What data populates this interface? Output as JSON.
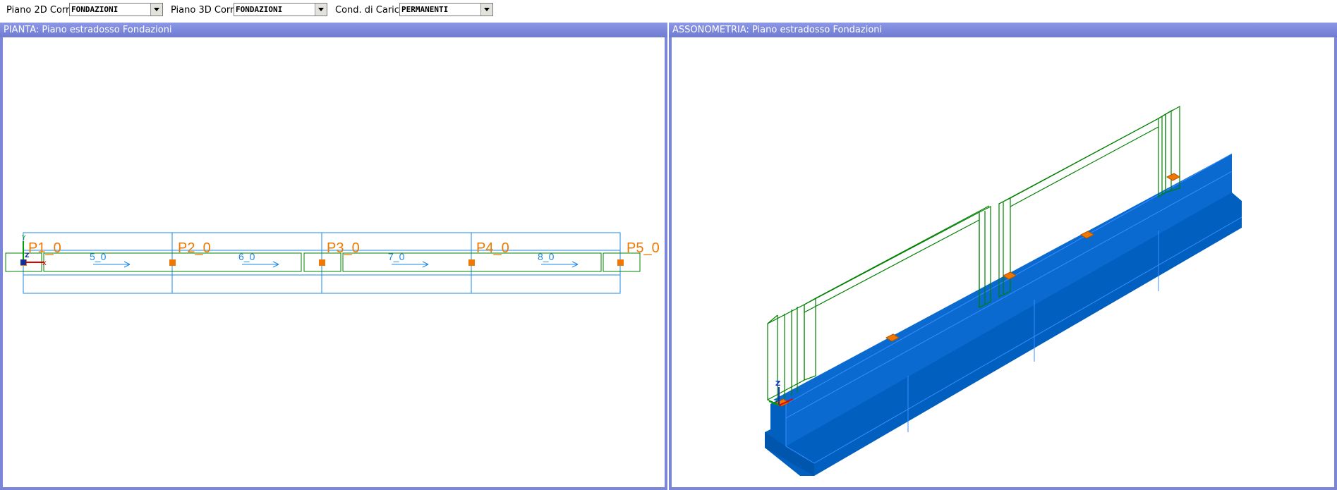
{
  "toolbar": {
    "piano2d_label": "Piano 2D Corr.",
    "piano2d_value": "FONDAZIONI",
    "piano3d_label": "Piano 3D Corr.",
    "piano3d_value": "FONDAZIONI",
    "cond_label": "Cond. di Carico",
    "cond_value": "PERMANENTI"
  },
  "plan_view": {
    "title": "PIANTA: Piano estradosso Fondazioni",
    "pillars": [
      "P1_0",
      "P2_0",
      "P3_0",
      "P4_0",
      "P5_0"
    ],
    "beams": [
      "5_0",
      "6_0",
      "7_0",
      "8_0"
    ],
    "axis_labels": {
      "y": "Y",
      "z": "Z"
    }
  },
  "axon_view": {
    "title": "ASSONOMETRIA:  Piano estradosso Fondazioni",
    "axis_labels": {
      "z": "Z"
    }
  },
  "colors": {
    "title_bar": "#7b86d8",
    "foundation_blue": "#0060c0",
    "outline_green": "#008000",
    "pillar_orange": "#f07800",
    "grid_cyan": "#1e88e5"
  }
}
